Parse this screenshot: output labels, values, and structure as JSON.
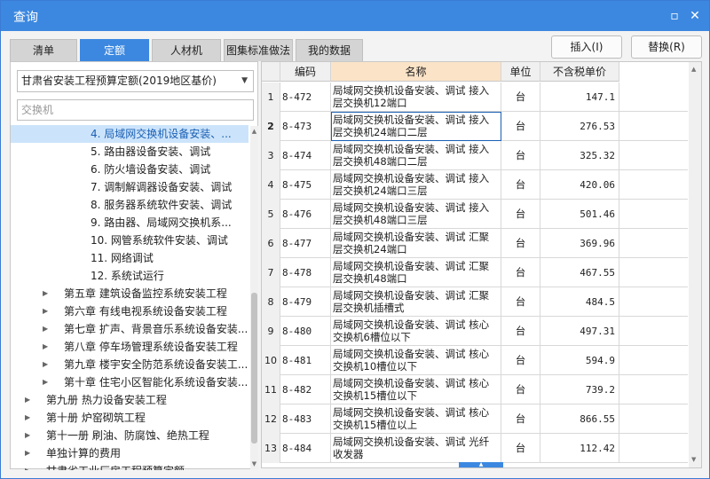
{
  "window": {
    "title": "查询",
    "maximize_icon": "maximize-icon",
    "close_icon": "close-icon"
  },
  "tabs": [
    "清单",
    "定额",
    "人材机",
    "图集标准做法",
    "我的数据"
  ],
  "active_tab": "定额",
  "buttons": {
    "insert": "插入(I)",
    "replace": "替换(R)"
  },
  "left": {
    "quota_select": "甘肃省安装工程预算定额(2019地区基价)",
    "search_value": "交换机"
  },
  "tree": [
    {
      "label": "4. 局域网交换机设备安装、...",
      "selected": true
    },
    {
      "label": "5. 路由器设备安装、调试"
    },
    {
      "label": "6. 防火墙设备安装、调试"
    },
    {
      "label": "7. 调制解调器设备安装、调试"
    },
    {
      "label": "8. 服务器系统软件安装、调试"
    },
    {
      "label": "9. 路由器、局域网交换机系..."
    },
    {
      "label": "10. 网管系统软件安装、调试"
    },
    {
      "label": "11. 网络调试"
    },
    {
      "label": "12. 系统试运行"
    },
    {
      "label": "第五章 建筑设备监控系统安装工程"
    },
    {
      "label": "第六章 有线电视系统设备安装工程"
    },
    {
      "label": "第七章 扩声、背景音乐系统设备安装..."
    },
    {
      "label": "第八章 停车场管理系统设备安装工程"
    },
    {
      "label": "第九章 楼宇安全防范系统设备安装工..."
    },
    {
      "label": "第十章 住宅小区智能化系统设备安装..."
    },
    {
      "label": "第九册 热力设备安装工程"
    },
    {
      "label": "第十册 炉窑砌筑工程"
    },
    {
      "label": "第十一册 刷油、防腐蚀、绝热工程"
    },
    {
      "label": "单独计算的费用"
    },
    {
      "label": "甘肃省工业厂房工程预算定额"
    }
  ],
  "grid": {
    "headers": {
      "code": "编码",
      "name": "名称",
      "unit": "单位",
      "price": "不含税单价"
    },
    "rows": [
      {
        "no": "1",
        "code": "8-472",
        "name": "局域网交换机设备安装、调试 接入层交换机12端口",
        "unit": "台",
        "price": "147.1"
      },
      {
        "no": "2",
        "code": "8-473",
        "name": "局域网交换机设备安装、调试 接入层交换机24端口二层",
        "unit": "台",
        "price": "276.53"
      },
      {
        "no": "3",
        "code": "8-474",
        "name": "局域网交换机设备安装、调试 接入层交换机48端口二层",
        "unit": "台",
        "price": "325.32"
      },
      {
        "no": "4",
        "code": "8-475",
        "name": "局域网交换机设备安装、调试 接入层交换机24端口三层",
        "unit": "台",
        "price": "420.06"
      },
      {
        "no": "5",
        "code": "8-476",
        "name": "局域网交换机设备安装、调试 接入层交换机48端口三层",
        "unit": "台",
        "price": "501.46"
      },
      {
        "no": "6",
        "code": "8-477",
        "name": "局域网交换机设备安装、调试 汇聚层交换机24端口",
        "unit": "台",
        "price": "369.96"
      },
      {
        "no": "7",
        "code": "8-478",
        "name": "局域网交换机设备安装、调试 汇聚层交换机48端口",
        "unit": "台",
        "price": "467.55"
      },
      {
        "no": "8",
        "code": "8-479",
        "name": "局域网交换机设备安装、调试 汇聚层交换机插槽式",
        "unit": "台",
        "price": "484.5"
      },
      {
        "no": "9",
        "code": "8-480",
        "name": "局域网交换机设备安装、调试 核心交换机6槽位以下",
        "unit": "台",
        "price": "497.31"
      },
      {
        "no": "10",
        "code": "8-481",
        "name": "局域网交换机设备安装、调试 核心交换机10槽位以下",
        "unit": "台",
        "price": "594.9"
      },
      {
        "no": "11",
        "code": "8-482",
        "name": "局域网交换机设备安装、调试 核心交换机15槽位以下",
        "unit": "台",
        "price": "739.2"
      },
      {
        "no": "12",
        "code": "8-483",
        "name": "局域网交换机设备安装、调试 核心交换机15槽位以上",
        "unit": "台",
        "price": "866.55"
      },
      {
        "no": "13",
        "code": "8-484",
        "name": "局域网交换机设备安装、调试 光纤收发器",
        "unit": "台",
        "price": "112.42"
      }
    ]
  }
}
